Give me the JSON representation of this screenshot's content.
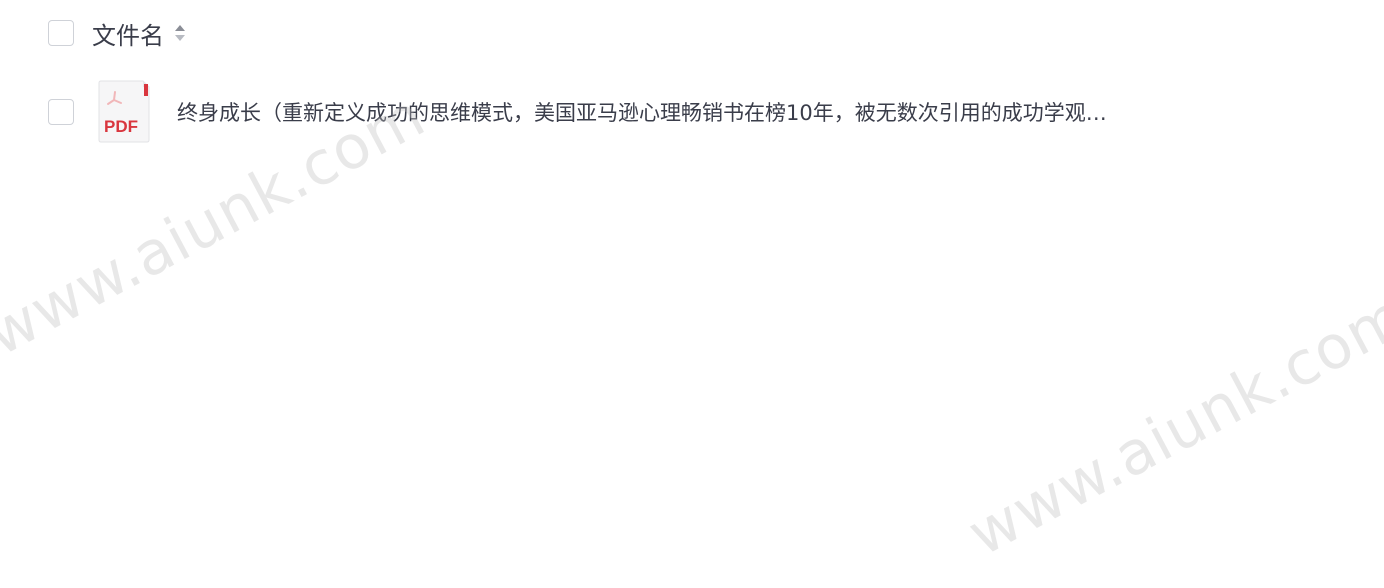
{
  "header": {
    "column_label": "文件名",
    "sort_icon": "sort-updown-icon"
  },
  "files": [
    {
      "type_icon": "pdf-file-icon",
      "type_label": "PDF",
      "name": "终身成长（重新定义成功的思维模式，美国亚马逊心理畅销书在榜10年，被无数次引用的成功学观…"
    }
  ],
  "watermarks": [
    "www.aiunk.com",
    "www.aiunk.com"
  ],
  "colors": {
    "pdf_red": "#d9363e",
    "text": "#3a3d4a",
    "checkbox_border": "#cfd2d8"
  }
}
